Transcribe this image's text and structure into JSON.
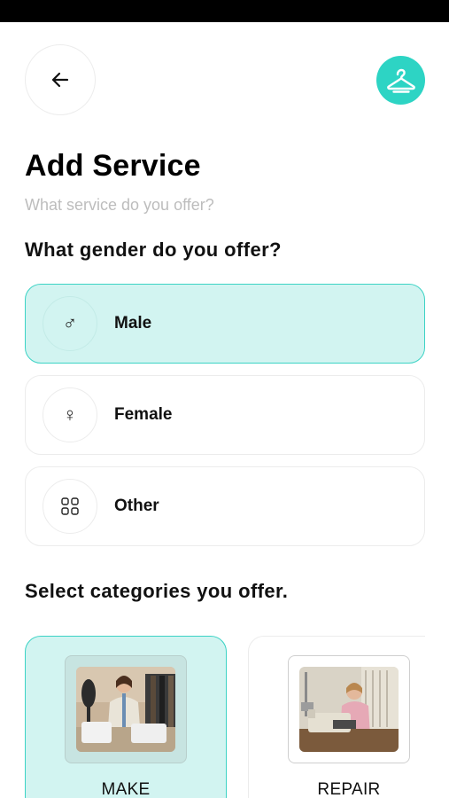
{
  "header": {
    "back_icon": "arrow-left-icon",
    "logo_icon": "hanger-icon",
    "accent_color": "#2dd4c4"
  },
  "page": {
    "title": "Add Service",
    "subtitle": "What service do you offer?"
  },
  "gender": {
    "title": "What gender do you offer?",
    "selected": "Male",
    "options": [
      {
        "label": "Male",
        "icon": "male-symbol-icon",
        "glyph": "♂"
      },
      {
        "label": "Female",
        "icon": "female-symbol-icon",
        "glyph": "♀"
      },
      {
        "label": "Other",
        "icon": "grid-icon",
        "glyph": ""
      }
    ]
  },
  "categories": {
    "title": "Select categories you offer.",
    "selected": "MAKE",
    "items": [
      {
        "label": "MAKE",
        "image": "tailor-making-clothes-photo"
      },
      {
        "label": "REPAIR",
        "image": "woman-sewing-machine-photo"
      }
    ]
  }
}
